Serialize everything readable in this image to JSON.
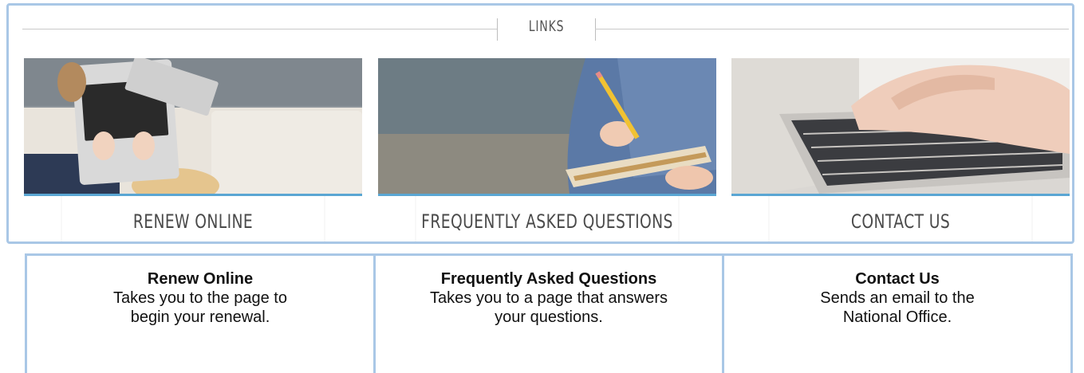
{
  "links_section": {
    "title": "LINKS",
    "cards": [
      {
        "label": "RENEW ONLINE",
        "image": "laptop-on-couch-photo"
      },
      {
        "label": "FREQUENTLY ASKED QUESTIONS",
        "image": "writing-notebook-photo"
      },
      {
        "label": "CONTACT US",
        "image": "typing-keyboard-photo"
      }
    ]
  },
  "descriptions": [
    {
      "title": "Renew Online",
      "text": "Takes you to the page to begin your renewal."
    },
    {
      "title": "Frequently Asked Questions",
      "text": "Takes you to a page that answers your questions."
    },
    {
      "title": "Contact Us",
      "text": "Sends an email to the National Office."
    }
  ],
  "colors": {
    "accent_blue": "#5aa6d3",
    "frame_blue": "#a9c7e6"
  }
}
